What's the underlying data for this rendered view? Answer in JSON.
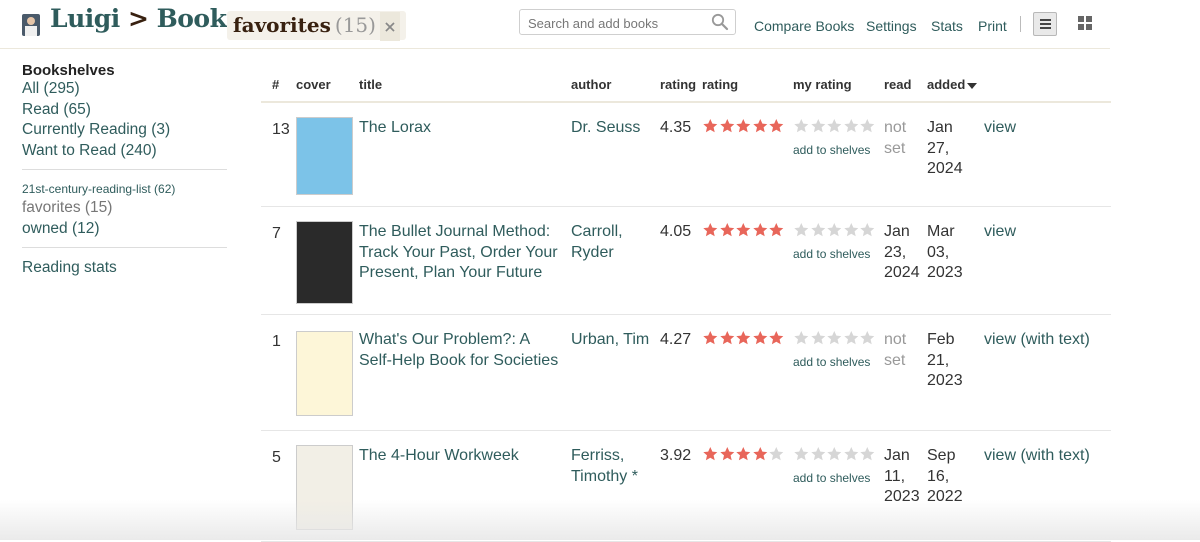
{
  "header": {
    "user": "Luigi",
    "separator": ">",
    "section": "Books:",
    "shelf_name": "favorites",
    "shelf_count": "(15)",
    "remove_symbol": "×",
    "search_placeholder": "Search and add books",
    "links": {
      "compare": "Compare Books",
      "settings": "Settings",
      "stats": "Stats",
      "print": "Print"
    }
  },
  "sidebar": {
    "heading": "Bookshelves",
    "main_shelves": [
      "All (295)",
      "Read (65)",
      "Currently Reading (3)",
      "Want to Read (240)"
    ],
    "custom_small": "21st-century-reading-list (62)",
    "custom_current": "favorites (15)",
    "custom_owned": "owned (12)",
    "reading_stats": "Reading stats"
  },
  "table": {
    "columns": [
      "#",
      "cover",
      "title",
      "author",
      "rating",
      "rating",
      "my rating",
      "read",
      "added"
    ],
    "add_to_shelves": "add to shelves",
    "rows": [
      {
        "num": "13",
        "title": "The Lorax",
        "author": "Dr. Seuss",
        "avg": "4.35",
        "stars": 5,
        "read": "not set",
        "added": "Jan 27, 2024",
        "view": "view",
        "cover_color": "#7cc3e8"
      },
      {
        "num": "7",
        "title": "The Bullet Journal Method: Track Your Past, Order Your Present, Plan Your Future",
        "author": "Carroll, Ryder",
        "avg": "4.05",
        "stars": 5,
        "read": "Jan 23, 2024",
        "added": "Mar 03, 2023",
        "view": "view",
        "cover_color": "#2a2a2a"
      },
      {
        "num": "1",
        "title": "What's Our Problem?: A Self-Help Book for Societies",
        "author": "Urban, Tim",
        "avg": "4.27",
        "stars": 5,
        "read": "not set",
        "added": "Feb 21, 2023",
        "view": "view (with text)",
        "cover_color": "#fdf6d8"
      },
      {
        "num": "5",
        "title": "The 4-Hour Workweek",
        "author": "Ferriss, Timothy *",
        "avg": "3.92",
        "stars": 4,
        "read": "Jan 11, 2023",
        "added": "Sep 16, 2022",
        "view": "view (with text)",
        "cover_color": "#f2efe6"
      }
    ]
  },
  "colors": {
    "star_filled": "#e8665a",
    "star_empty": "#d6d6d6",
    "link": "#2f5c5c",
    "heading": "#382110"
  }
}
